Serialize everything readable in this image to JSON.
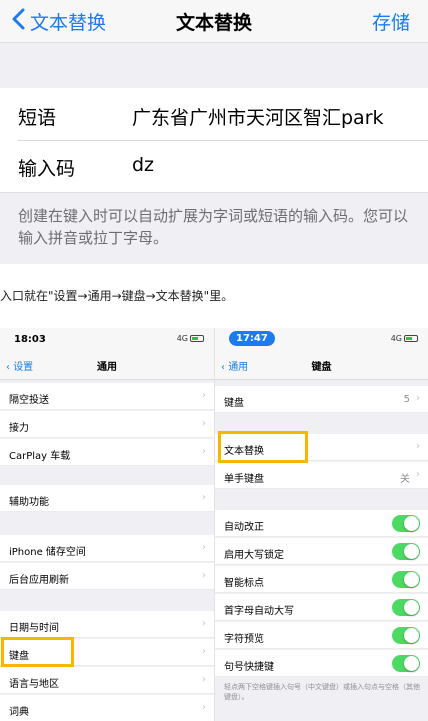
{
  "nav": {
    "back_label": "文本替换",
    "title": "文本替换",
    "save_label": "存储"
  },
  "form": {
    "phrase_label": "短语",
    "phrase_value": "广东省广州市天河区智汇park",
    "shortcut_label": "输入码",
    "shortcut_value": "dz"
  },
  "hint": "创建在键入时可以自动扩展为字词或短语的输入码。您可以输入拼音或拉丁字母。",
  "caption": "入口就在\"设置→通用→键盘→文本替换\"里。",
  "left_phone": {
    "time": "18:03",
    "signal": "4G",
    "back_label": "设置",
    "title": "通用",
    "items": [
      "隔空投送",
      "接力",
      "CarPlay 车载",
      "辅助功能",
      "iPhone 储存空间",
      "后台应用刷新",
      "日期与时间",
      "键盘",
      "语言与地区",
      "词典"
    ]
  },
  "right_phone": {
    "time": "17:47",
    "signal": "4G",
    "back_label": "通用",
    "title": "键盘",
    "keyboards_label": "键盘",
    "keyboards_count": "5",
    "text_replace_label": "文本替换",
    "one_hand_label": "单手键盘",
    "one_hand_value": "关",
    "toggles": [
      "自动改正",
      "启用大写锁定",
      "智能标点",
      "首字母自动大写",
      "字符预览",
      "句号快捷键"
    ],
    "footnote": "轻点两下空格键插入句号（中文键盘）或插入句点与空格（其他键盘）。"
  },
  "colors": {
    "accent": "#1a7cf0",
    "highlight": "#f5b700",
    "toggle_on": "#4cd964"
  }
}
